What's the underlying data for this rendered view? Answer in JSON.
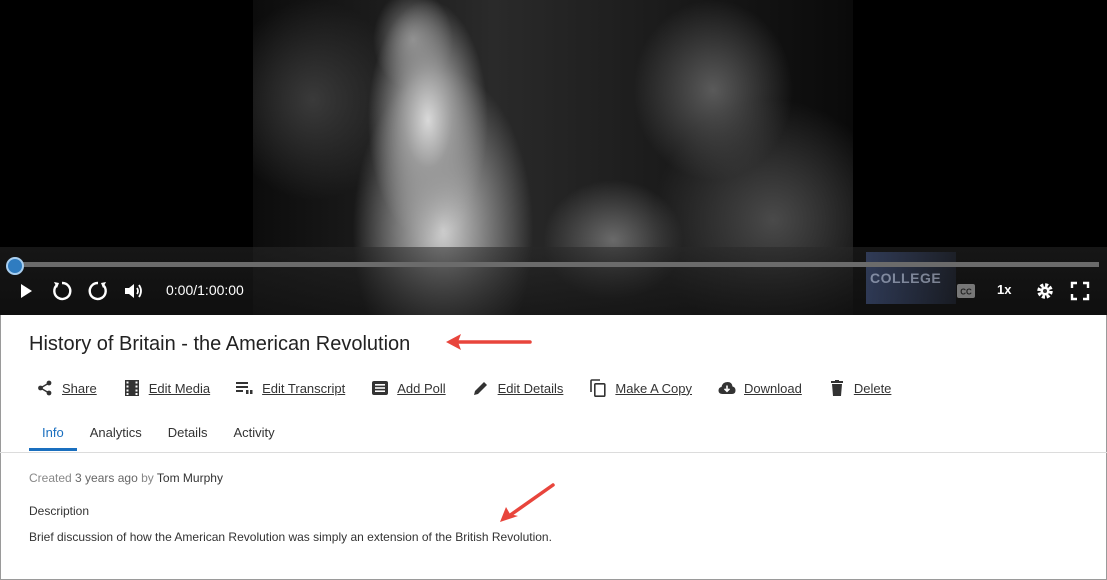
{
  "player": {
    "time": "0:00/1:00:00",
    "progress_fraction": 0.0,
    "playback_rate": "1x",
    "watermark": "COLLEGE",
    "cc_label": "CC"
  },
  "media": {
    "title": "History of Britain - the American Revolution"
  },
  "actions": [
    {
      "label": "Share",
      "icon": "share-icon"
    },
    {
      "label": "Edit Media",
      "icon": "film-icon"
    },
    {
      "label": "Edit Transcript",
      "icon": "transcript-icon"
    },
    {
      "label": "Add Poll",
      "icon": "poll-icon"
    },
    {
      "label": "Edit Details",
      "icon": "pencil-icon"
    },
    {
      "label": "Make A Copy",
      "icon": "copy-icon"
    },
    {
      "label": "Download",
      "icon": "cloud-download-icon"
    },
    {
      "label": "Delete",
      "icon": "trash-icon"
    }
  ],
  "tabs": [
    {
      "label": "Info",
      "active": true
    },
    {
      "label": "Analytics",
      "active": false
    },
    {
      "label": "Details",
      "active": false
    },
    {
      "label": "Activity",
      "active": false
    }
  ],
  "info": {
    "created_prefix": "Created",
    "created_ago": "3 years ago",
    "by": "by",
    "author": "Tom Murphy",
    "description_label": "Description",
    "description": "Brief discussion of how the American Revolution was simply an extension of the British Revolution."
  },
  "colors": {
    "accent": "#1a6fbf",
    "arrow": "#e8453c"
  }
}
